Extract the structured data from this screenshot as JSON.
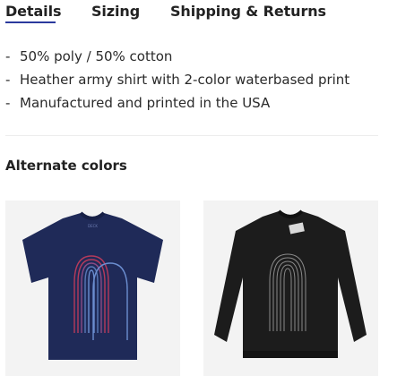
{
  "tabs": {
    "details": "Details",
    "sizing": "Sizing",
    "shipping": "Shipping & Returns",
    "active": "Details",
    "accent_color": "#2b3a9d"
  },
  "features": [
    "50% poly / 50% cotton",
    "Heather army shirt with 2-color waterbased print",
    "Manufactured and printed in the USA"
  ],
  "alternate_colors": {
    "title": "Alternate colors",
    "items": [
      {
        "name": "navy t-shirt",
        "color": "#1f2a58"
      },
      {
        "name": "black crewneck sweatshirt",
        "color": "#1c1c1c"
      }
    ]
  },
  "icons": {
    "bullet": "-"
  }
}
